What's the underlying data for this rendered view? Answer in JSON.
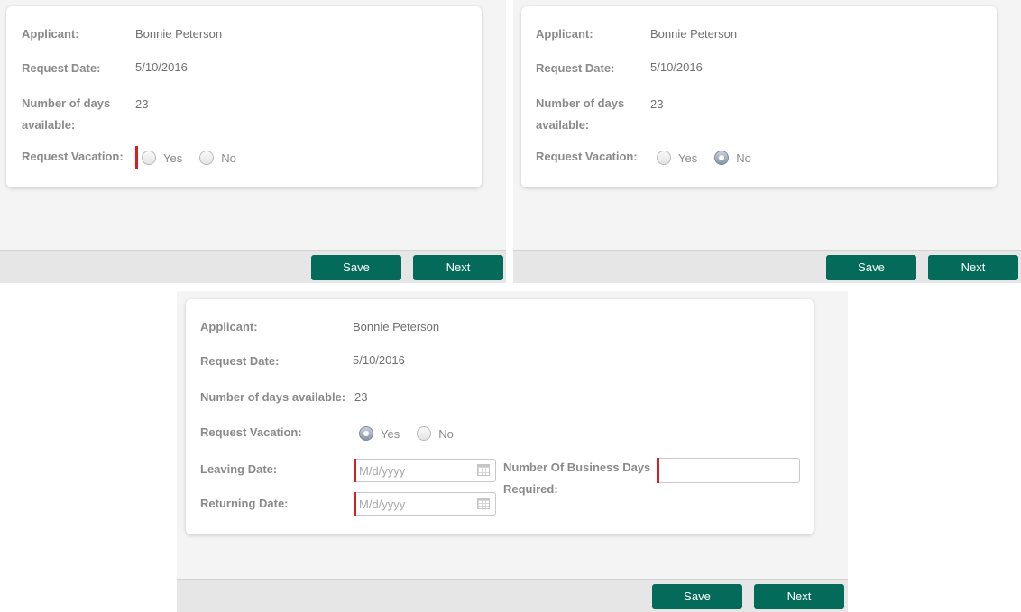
{
  "colors": {
    "accent": "#046b5b",
    "required": "#d61f1f",
    "label": "#8a8a8a",
    "panel_bg": "#f4f4f4",
    "footer_bg": "#e6e6e6"
  },
  "panels": [
    {
      "applicant_label": "Applicant:",
      "applicant_value": "Bonnie Peterson",
      "request_date_label": "Request Date:",
      "request_date_value": "5/10/2016",
      "days_label_line1": "Number of days",
      "days_label_line2": "available:",
      "days_value": "23",
      "vacation_label": "Request Vacation:",
      "yes_label": "Yes",
      "no_label": "No",
      "selected": "none",
      "save_label": "Save",
      "next_label": "Next"
    },
    {
      "applicant_label": "Applicant:",
      "applicant_value": "Bonnie Peterson",
      "request_date_label": "Request Date:",
      "request_date_value": "5/10/2016",
      "days_label_line1": "Number of days",
      "days_label_line2": "available:",
      "days_value": "23",
      "vacation_label": "Request Vacation:",
      "yes_label": "Yes",
      "no_label": "No",
      "selected": "no",
      "save_label": "Save",
      "next_label": "Next"
    },
    {
      "applicant_label": "Applicant:",
      "applicant_value": "Bonnie Peterson",
      "request_date_label": "Request Date:",
      "request_date_value": "5/10/2016",
      "days_label": "Number of days available:",
      "days_value": "23",
      "vacation_label": "Request Vacation:",
      "yes_label": "Yes",
      "no_label": "No",
      "selected": "yes",
      "leaving_label": "Leaving Date:",
      "leaving_value": "",
      "leaving_placeholder": "M/d/yyyy",
      "returning_label": "Returning Date:",
      "returning_value": "",
      "returning_placeholder": "M/d/yyyy",
      "business_days_label_line1": "Number Of Business Days",
      "business_days_label_line2": "Required:",
      "business_days_value": "",
      "save_label": "Save",
      "next_label": "Next"
    }
  ]
}
